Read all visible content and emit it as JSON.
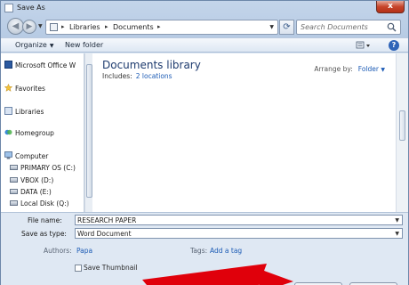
{
  "window": {
    "title": "Save As",
    "close_glyph": "x"
  },
  "nav": {
    "back_glyph": "◀",
    "forward_glyph": "▶",
    "breadcrumb": [
      "Libraries",
      "Documents"
    ],
    "separator": "▸",
    "search_placeholder": "Search Documents",
    "refresh_glyph": "⟳"
  },
  "toolbar": {
    "organize_label": "Organize",
    "new_folder_label": "New folder",
    "help_label": "?"
  },
  "sidebar": {
    "items": [
      {
        "label": "Microsoft Office W",
        "icon": "word-icon"
      },
      {
        "label": "Favorites",
        "icon": "star-icon"
      },
      {
        "label": "Libraries",
        "icon": "library-icon"
      },
      {
        "label": "Homegroup",
        "icon": "homegroup-icon"
      },
      {
        "label": "Computer",
        "icon": "computer-icon"
      },
      {
        "label": "PRIMARY OS (C:)",
        "icon": "drive-icon"
      },
      {
        "label": "VBOX (D:)",
        "icon": "drive-icon"
      },
      {
        "label": "DATA (E:)",
        "icon": "drive-icon"
      },
      {
        "label": "Local Disk (Q:)",
        "icon": "drive-icon"
      }
    ]
  },
  "content": {
    "title": "Documents library",
    "includes_label": "Includes:",
    "includes_value": "2 locations",
    "arrange_label": "Arrange by:",
    "arrange_value": "Folder"
  },
  "form": {
    "file_name_label": "File name:",
    "file_name_value": "RESEARCH PAPER",
    "save_type_label": "Save as type:",
    "save_type_value": "Word Document",
    "authors_label": "Authors:",
    "authors_value": "Papa",
    "tags_label": "Tags:",
    "tags_value": "Add a tag",
    "thumbnail_label": "Save Thumbnail"
  },
  "colors": {
    "accent": "#1c5bb5",
    "title_text": "#1e3b6e",
    "close": "#c7452b",
    "annotation": "#e0000b"
  }
}
